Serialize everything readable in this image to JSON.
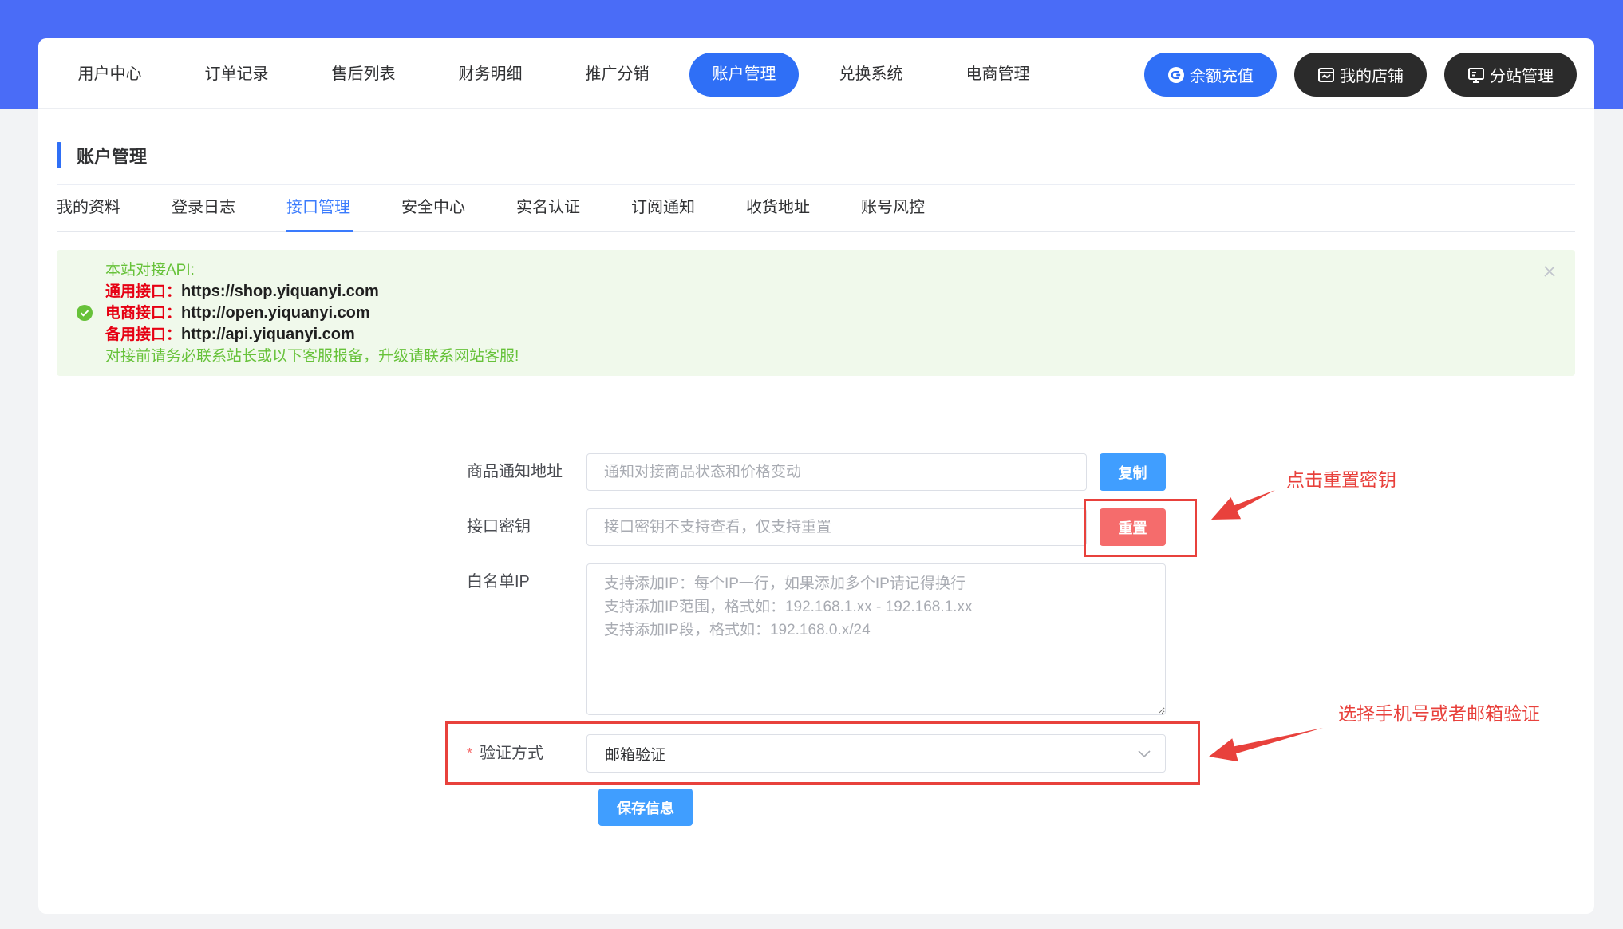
{
  "colors": {
    "header_band": "#4a6cf7",
    "page_background": "#f2f3f5",
    "primary": "#2f6ff6",
    "tab_active": "#3a7bfd",
    "button_blue": "#409eff",
    "danger": "#f56c6c",
    "dark_button": "#2b2b2b",
    "success_background": "#f0f9eb",
    "success_text": "#67c23a",
    "api_label_red": "#e60012",
    "annotation_red": "#e8413c"
  },
  "topnav": {
    "items": [
      {
        "label": "用户中心",
        "active": false
      },
      {
        "label": "订单记录",
        "active": false
      },
      {
        "label": "售后列表",
        "active": false
      },
      {
        "label": "财务明细",
        "active": false
      },
      {
        "label": "推广分销",
        "active": false
      },
      {
        "label": "账户管理",
        "active": true
      },
      {
        "label": "兑换系统",
        "active": false
      },
      {
        "label": "电商管理",
        "active": false
      }
    ],
    "actions": [
      {
        "label": "余额充值",
        "icon": "recharge-icon"
      },
      {
        "label": "我的店铺",
        "icon": "store-icon"
      },
      {
        "label": "分站管理",
        "icon": "substation-icon"
      }
    ]
  },
  "page": {
    "title": "账户管理",
    "tabs": [
      {
        "label": "我的资料",
        "active": false
      },
      {
        "label": "登录日志",
        "active": false
      },
      {
        "label": "接口管理",
        "active": true
      },
      {
        "label": "安全中心",
        "active": false
      },
      {
        "label": "实名认证",
        "active": false
      },
      {
        "label": "订阅通知",
        "active": false
      },
      {
        "label": "收货地址",
        "active": false
      },
      {
        "label": "账号风控",
        "active": false
      }
    ]
  },
  "alert": {
    "icon": "check-circle-icon",
    "close_icon": "close-icon",
    "heading": "本站对接API:",
    "apis": [
      {
        "label": "通用接口：",
        "url": "https://shop.yiquanyi.com"
      },
      {
        "label": "电商接口：",
        "url": "http://open.yiquanyi.com"
      },
      {
        "label": "备用接口：",
        "url": "http://api.yiquanyi.com"
      }
    ],
    "note": "对接前请务必联系站长或以下客服报备，升级请联系网站客服!"
  },
  "form": {
    "notify_url": {
      "label": "商品通知地址",
      "value": "",
      "placeholder": "通知对接商品状态和价格变动",
      "button": "复制"
    },
    "api_key": {
      "label": "接口密钥",
      "value": "",
      "placeholder": "接口密钥不支持查看，仅支持重置",
      "button": "重置"
    },
    "ip_whitelist": {
      "label": "白名单IP",
      "value": "",
      "placeholder": "支持添加IP：每个IP一行，如果添加多个IP请记得换行\n支持添加IP范围，格式如：192.168.1.xx - 192.168.1.xx\n支持添加IP段，格式如：192.168.0.x/24"
    },
    "verify_method": {
      "required_mark": "*",
      "label": "验证方式",
      "selected": "邮箱验证",
      "icon": "chevron-down-icon"
    },
    "save_button": "保存信息"
  },
  "annotations": [
    {
      "text": "点击重置密钥"
    },
    {
      "text": "选择手机号或者邮箱验证"
    }
  ]
}
